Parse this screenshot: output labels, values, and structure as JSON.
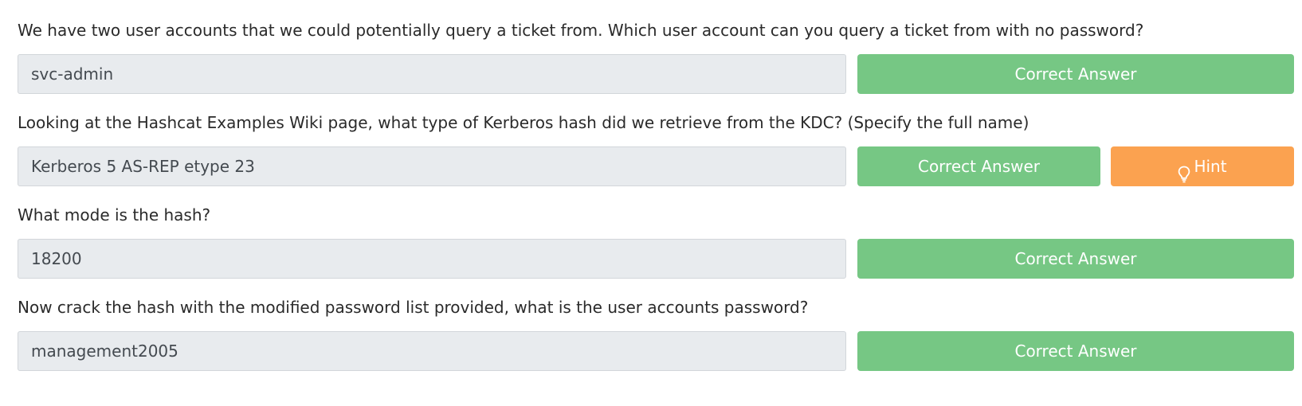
{
  "questions": [
    {
      "text": "We have two user accounts that we could potentially query a ticket from. Which user account can you query a ticket from with no password?",
      "answer": "svc-admin",
      "button_label": "Correct Answer"
    },
    {
      "text": "Looking at the Hashcat Examples Wiki page, what type of Kerberos hash did we retrieve from the KDC? (Specify the full name)",
      "answer": "Kerberos 5 AS-REP etype 23",
      "button_label": "Correct Answer",
      "hint_label": "Hint",
      "hint_icon": "lightbulb-icon"
    },
    {
      "text": "What mode is the hash?",
      "answer": "18200",
      "button_label": "Correct Answer"
    },
    {
      "text": "Now crack the hash with the modified password list provided, what is the user accounts password?",
      "answer": "management2005",
      "button_label": "Correct Answer"
    }
  ],
  "colors": {
    "correct": "#76c784",
    "hint": "#fba250",
    "field_bg": "#e8ebee"
  }
}
